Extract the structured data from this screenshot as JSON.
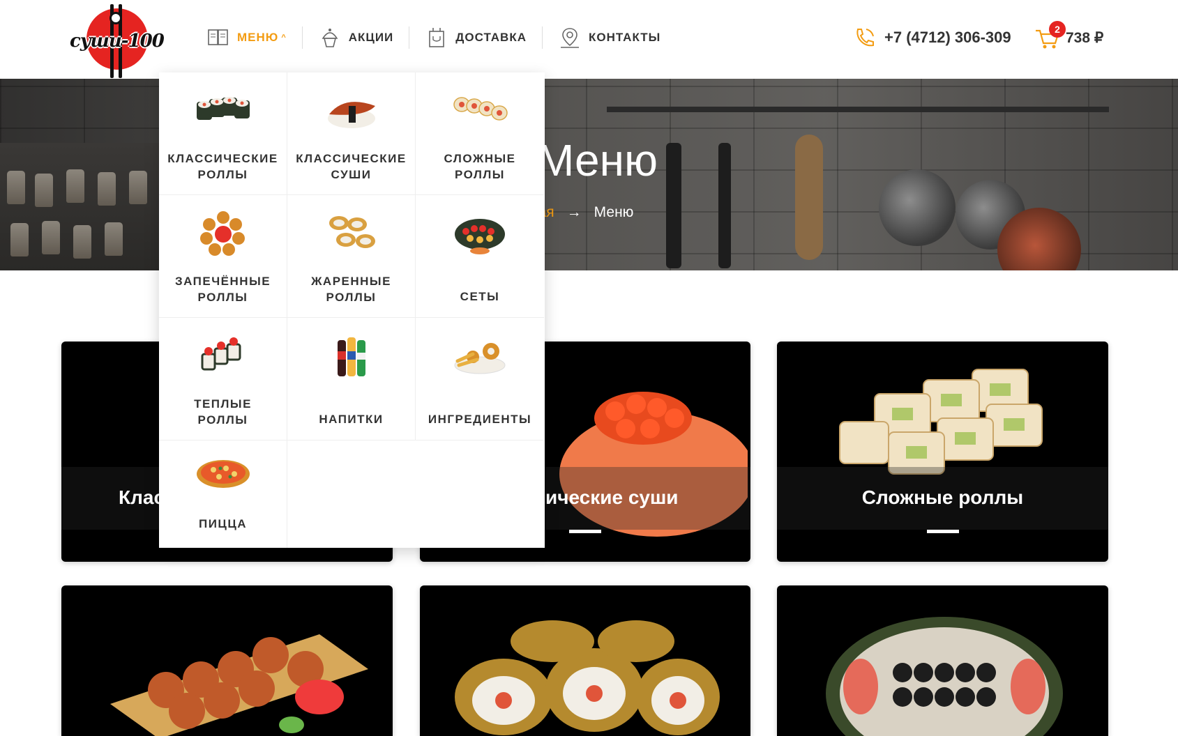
{
  "brand": {
    "logo_text": "суши-100"
  },
  "nav": {
    "items": [
      {
        "label": "МЕНЮ",
        "icon": "menu-book-icon"
      },
      {
        "label": "АКЦИИ",
        "icon": "cupcake-icon"
      },
      {
        "label": "ДОСТАВКА",
        "icon": "delivery-box-icon"
      },
      {
        "label": "КОНТАКТЫ",
        "icon": "map-pin-icon"
      }
    ],
    "active_caret": "^"
  },
  "contact": {
    "phone": "+7 (4712) 306-309"
  },
  "cart": {
    "count": "2",
    "total": "738 ₽"
  },
  "hero": {
    "title": "Меню",
    "crumb_home": "ная",
    "crumb_sep": "→",
    "crumb_current": "Меню"
  },
  "dropdown": {
    "items": [
      {
        "label": "КЛАССИЧЕСКИЕ\nРОЛЛЫ",
        "icon": "classic-rolls-icon"
      },
      {
        "label": "КЛАССИЧЕСКИЕ\nСУШИ",
        "icon": "classic-sushi-icon"
      },
      {
        "label": "СЛОЖНЫЕ\nРОЛЛЫ",
        "icon": "complex-rolls-icon"
      },
      {
        "label": "ЗАПЕЧЁННЫЕ\nРОЛЛЫ",
        "icon": "baked-rolls-icon"
      },
      {
        "label": "ЖАРЕННЫЕ\nРОЛЛЫ",
        "icon": "fried-rolls-icon"
      },
      {
        "label": "СЕТЫ",
        "icon": "sets-icon"
      },
      {
        "label": "ТЕПЛЫЕ\nРОЛЛЫ",
        "icon": "warm-rolls-icon"
      },
      {
        "label": "НАПИТКИ",
        "icon": "drinks-icon"
      },
      {
        "label": "ИНГРЕДИЕНТЫ",
        "icon": "ingredients-icon"
      },
      {
        "label": "ПИЦЦА",
        "icon": "pizza-icon"
      }
    ]
  },
  "cards": {
    "c1": {
      "label": "Клас"
    },
    "c2": {
      "label": "ические суши"
    },
    "c3": {
      "label": "Сложные роллы"
    },
    "c4": {
      "label": ""
    },
    "c5": {
      "label": ""
    },
    "c6": {
      "label": ""
    }
  },
  "colors": {
    "accent": "#f39c12",
    "brand_red": "#e52421",
    "text": "#333333"
  }
}
